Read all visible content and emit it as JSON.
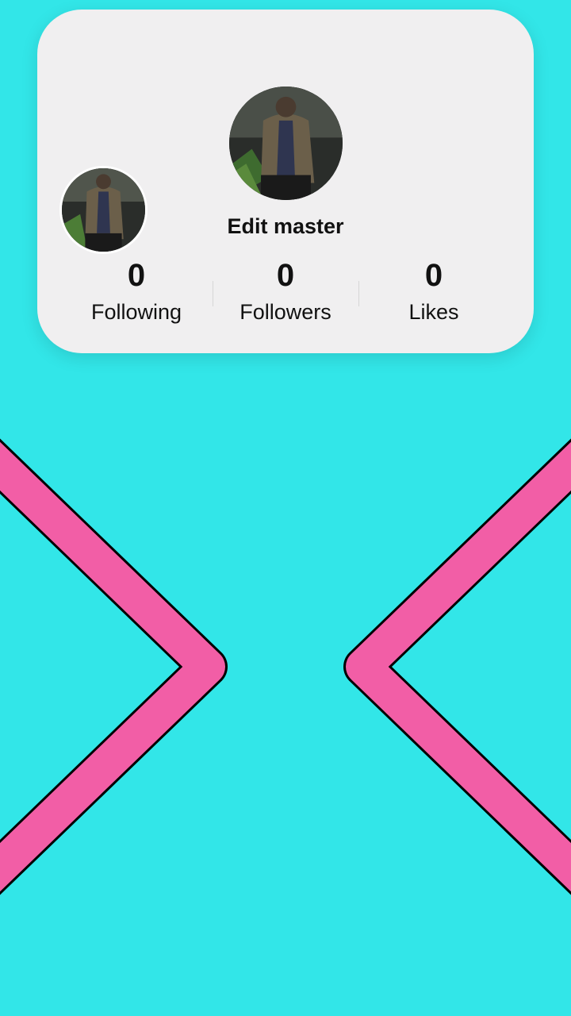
{
  "profile": {
    "username": "Edit master",
    "avatar_main": "profile-photo",
    "avatar_small": "profile-photo"
  },
  "stats": [
    {
      "value": "0",
      "label": "Following"
    },
    {
      "value": "0",
      "label": "Followers"
    },
    {
      "value": "0",
      "label": "Likes"
    }
  ],
  "decor": {
    "left_shape": "chevron-right-icon",
    "right_shape": "chevron-left-icon",
    "background_color": "#32e6e8",
    "chevron_color": "#f25ea6"
  }
}
